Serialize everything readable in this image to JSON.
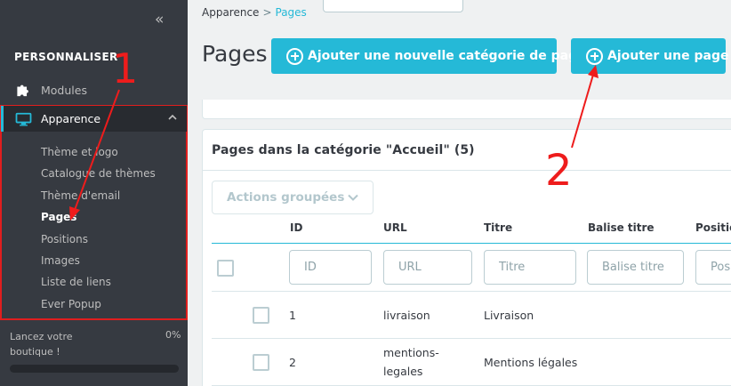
{
  "sidebar": {
    "collapse_label": "«",
    "section_title": "PERSONNALISER",
    "modules_label": "Modules",
    "apparence_label": "Apparence",
    "subitems": [
      "Thème et logo",
      "Catalogue de thèmes",
      "Thème d'email",
      "Pages",
      "Positions",
      "Images",
      "Liste de liens",
      "Ever Popup"
    ],
    "launch_label": "Lancez votre boutique !",
    "launch_progress": "0%",
    "launch_progress_value": 0
  },
  "breadcrumb": {
    "parent": "Apparence",
    "separator": ">",
    "current": "Pages"
  },
  "page_title": "Pages",
  "buttons": {
    "add_category": "Ajouter une nouvelle catégorie de page",
    "add_page": "Ajouter une page"
  },
  "panel": {
    "title": "Pages dans la catégorie \"Accueil\" (5)",
    "bulk_actions": "Actions groupées",
    "columns": [
      "ID",
      "URL",
      "Titre",
      "Balise titre",
      "Position"
    ],
    "filter_placeholders": [
      "ID",
      "URL",
      "Titre",
      "Balise titre",
      "Pos"
    ],
    "rows": [
      {
        "id": "1",
        "url": "livraison",
        "title": "Livraison"
      },
      {
        "id": "2",
        "url": "mentions-\nlegales",
        "title": "Mentions légales"
      }
    ]
  },
  "annotations": {
    "label_1": "1",
    "label_2": "2"
  },
  "colors": {
    "accent": "#25b9d7",
    "sidebar_bg": "#363a41",
    "annotation_red": "#ee1c1c"
  }
}
